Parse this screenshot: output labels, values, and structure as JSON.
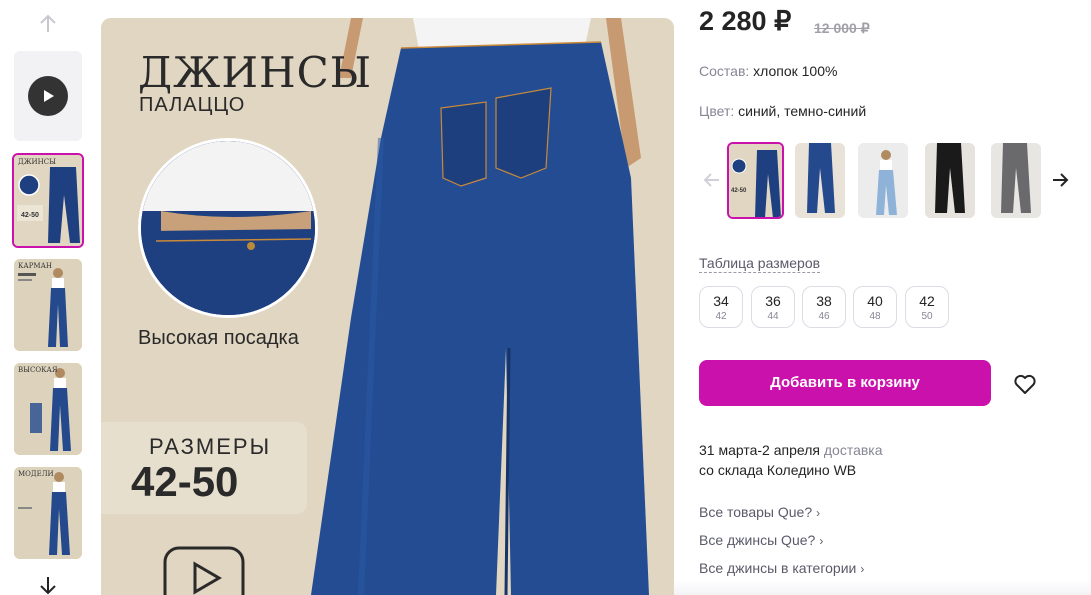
{
  "gallery": {
    "thumbnails": [
      {
        "kind": "video"
      },
      {
        "kind": "photo",
        "caption": "ДЖИНСЫ",
        "selected": true
      },
      {
        "kind": "photo",
        "caption": "КАРМАН"
      },
      {
        "kind": "photo",
        "caption": "ВЫСОКАЯ"
      },
      {
        "kind": "photo",
        "caption": "МОДЕЛИ"
      }
    ],
    "main_image": {
      "title": "ДЖИНСЫ",
      "subtitle": "ПАЛАЦЦО",
      "feature": "Высокая посадка",
      "sizes_label": "РАЗМЕРЫ",
      "sizes_range": "42-50"
    }
  },
  "product": {
    "price": "2 280 ₽",
    "old_price": "12 000 ₽",
    "composition_label": "Состав:",
    "composition_value": "хлопок 100%",
    "color_label": "Цвет:",
    "color_value": "синий, темно-синий",
    "color_variants": [
      "dark-blue-jeans",
      "blue-jeans",
      "light-blue-jeans",
      "black-jeans",
      "grey-jeans"
    ],
    "size_table_link": "Таблица размеров",
    "sizes": [
      {
        "ru": "34",
        "intl": "42"
      },
      {
        "ru": "36",
        "intl": "44"
      },
      {
        "ru": "38",
        "intl": "46"
      },
      {
        "ru": "40",
        "intl": "48"
      },
      {
        "ru": "42",
        "intl": "50"
      }
    ],
    "add_to_cart": "Добавить в корзину",
    "delivery_date": "31 марта-2 апреля",
    "delivery_word": "доставка",
    "delivery_from": "со склада Коледино WB",
    "links": [
      "Все товары Que?",
      "Все джинсы Que?",
      "Все джинсы в категории"
    ]
  },
  "colors": {
    "accent": "#cb11ab",
    "denim": "#1e3f80",
    "background_beige": "#e0d6c1"
  },
  "icons": [
    "arrow-up-icon",
    "arrow-down-icon",
    "play-icon",
    "youtube-icon",
    "arrow-left-icon",
    "arrow-right-icon",
    "heart-icon",
    "chevron-right-icon"
  ]
}
